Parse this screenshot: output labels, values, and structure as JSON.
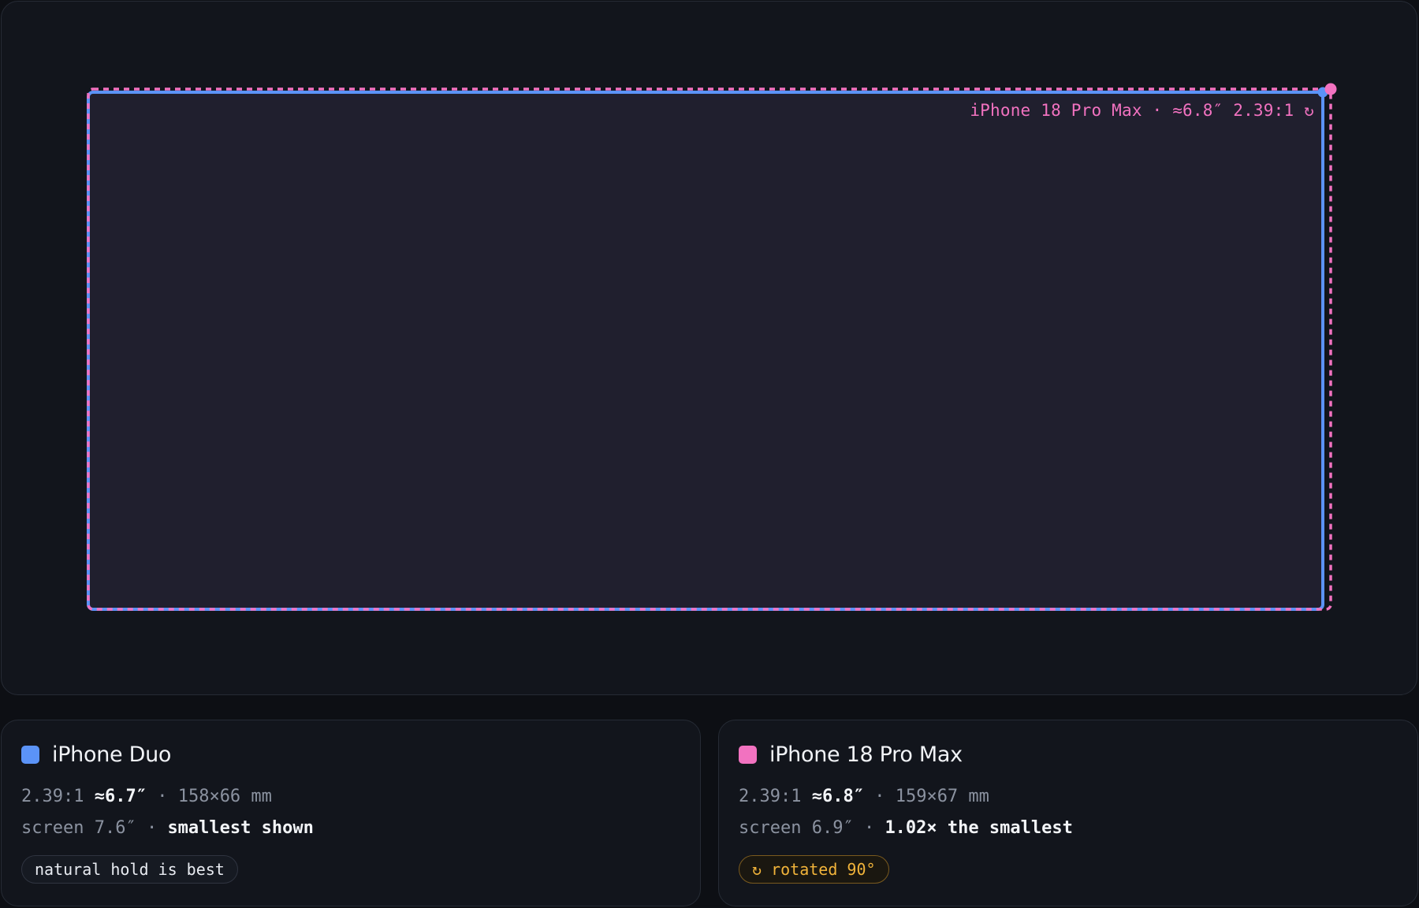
{
  "stage": {
    "overlay_label": "iPhone 18 Pro Max · ≈6.8″ 2.39:1 ↻",
    "colors": {
      "duo": "#5b93f7",
      "pro_max": "#f272c0",
      "screen_fill": "#201f2e"
    }
  },
  "cards": [
    {
      "title": "iPhone Duo",
      "color": "#5b93f7",
      "ratio": "2.39:1",
      "diag": "≈6.7″",
      "dims": "· 158×66 mm",
      "screen": "screen 7.6″ ·",
      "note": "smallest shown",
      "chip": "natural hold is best"
    },
    {
      "title": "iPhone 18 Pro Max",
      "color": "#f272c0",
      "ratio": "2.39:1",
      "diag": "≈6.8″",
      "dims": "· 159×67 mm",
      "screen": "screen 6.9″ ·",
      "note": "1.02× the smallest",
      "chip": "↻ rotated 90°"
    }
  ]
}
